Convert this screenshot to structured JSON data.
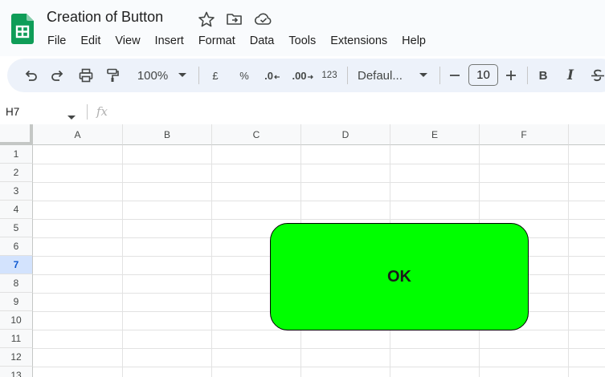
{
  "document": {
    "title": "Creation of Button"
  },
  "menu": [
    "File",
    "Edit",
    "View",
    "Insert",
    "Format",
    "Data",
    "Tools",
    "Extensions",
    "Help"
  ],
  "toolbar": {
    "zoom": "100%",
    "currency": "£",
    "percent": "%",
    "decrease_decimal": ".0",
    "increase_decimal": ".00",
    "number_format": "123",
    "font_family": "Defaul...",
    "font_size": "10",
    "bold": "B",
    "italic": "I"
  },
  "formula_bar": {
    "cell_reference": "H7",
    "fx_label": "fx",
    "formula_value": ""
  },
  "grid": {
    "columns": [
      "A",
      "B",
      "C",
      "D",
      "E",
      "F"
    ],
    "rows": [
      "1",
      "2",
      "3",
      "4",
      "5",
      "6",
      "7",
      "8",
      "9",
      "10",
      "11",
      "12",
      "13"
    ],
    "selected_row": "7"
  },
  "drawing": {
    "label": "OK",
    "fill_color": "#00ff00",
    "border_color": "#000000"
  },
  "colors": {
    "sheets_green": "#0f9d58",
    "toolbar_bg": "#edf2fa",
    "header_bg": "#f9fbfd",
    "selected_header": "#d3e3fd"
  }
}
